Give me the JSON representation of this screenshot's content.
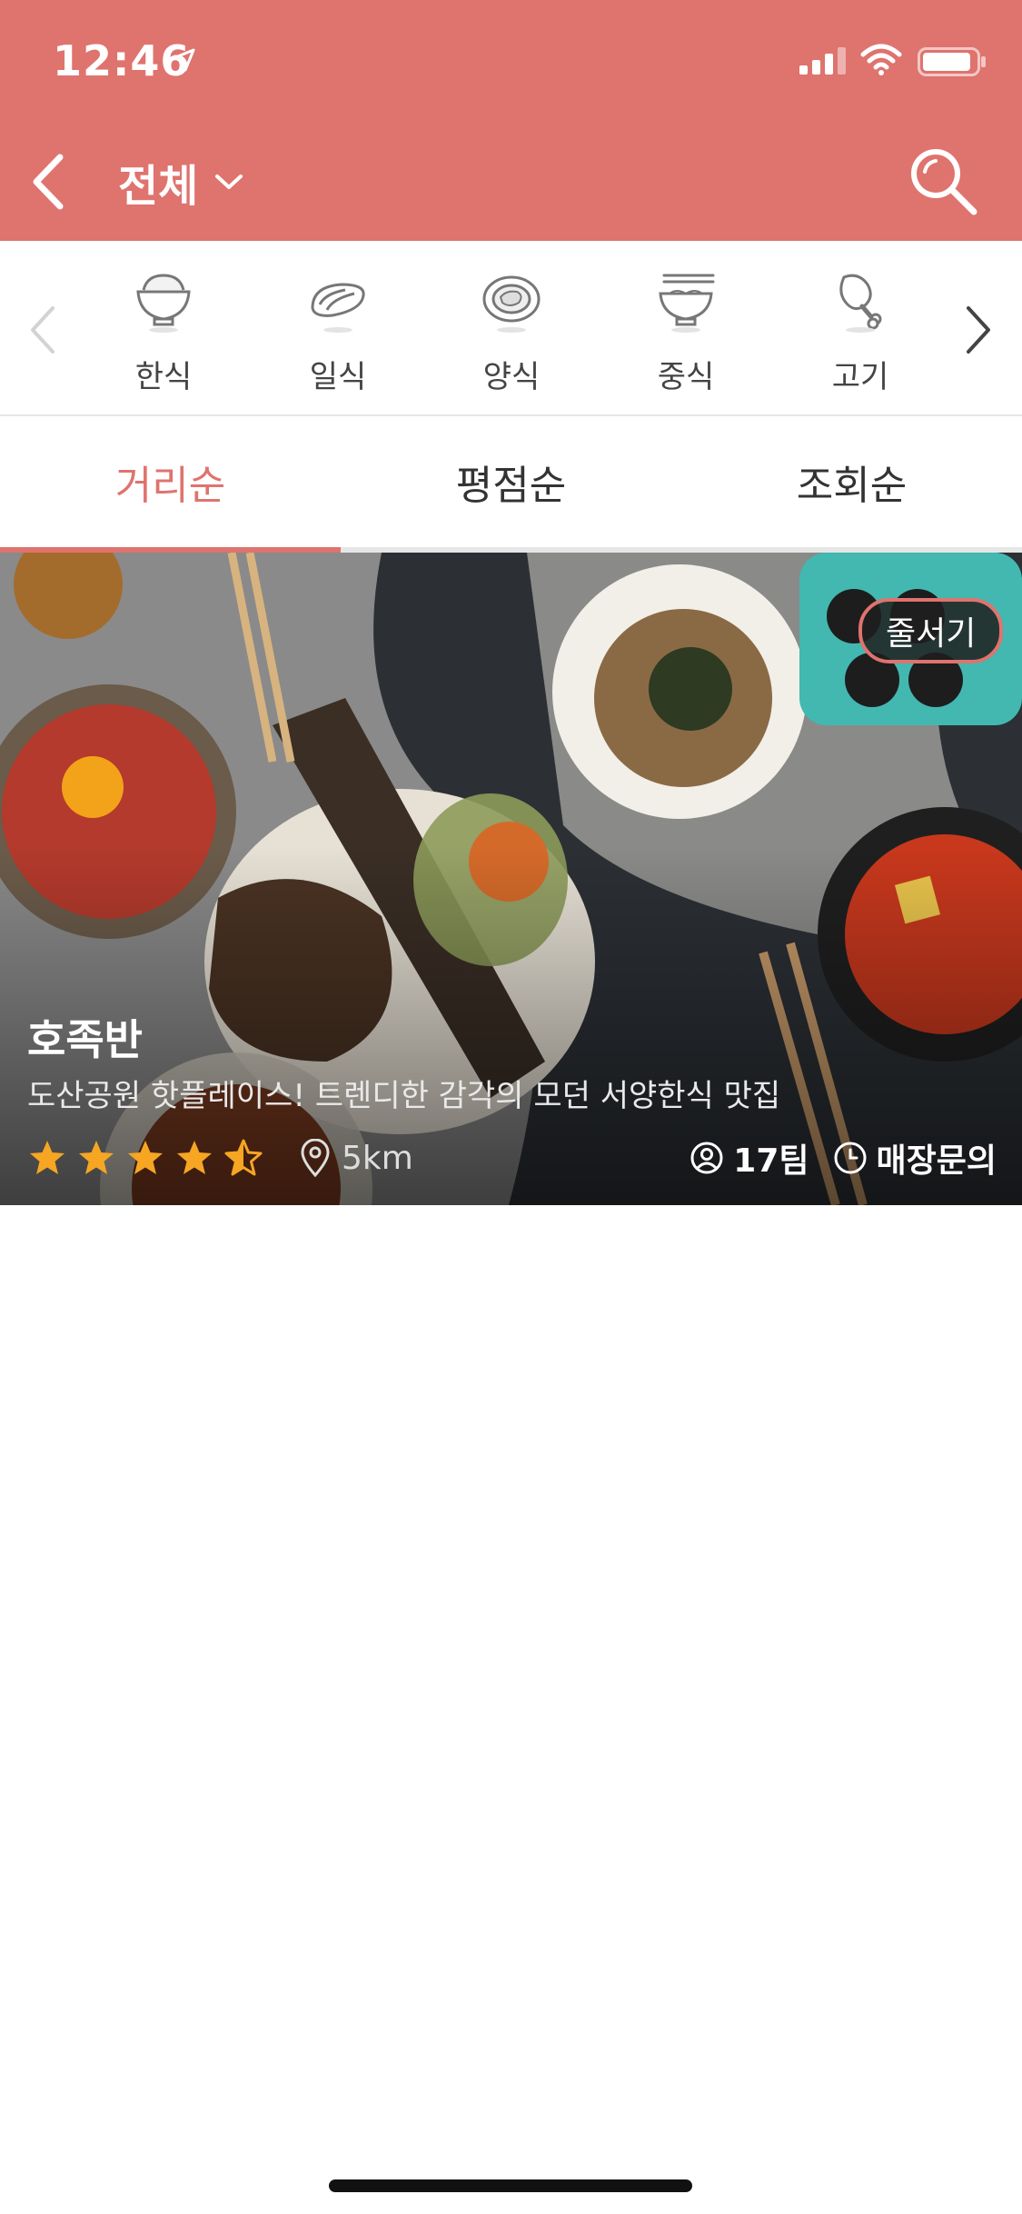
{
  "status_bar": {
    "time": "12:46"
  },
  "nav": {
    "title": "전체"
  },
  "categories": [
    {
      "label": "한식",
      "icon": "rice-bowl-icon"
    },
    {
      "label": "일식",
      "icon": "sushi-icon"
    },
    {
      "label": "양식",
      "icon": "steak-plate-icon"
    },
    {
      "label": "중식",
      "icon": "noodle-bowl-icon"
    },
    {
      "label": "고기",
      "icon": "drumstick-icon"
    }
  ],
  "tabs": [
    {
      "label": "거리순",
      "active": true
    },
    {
      "label": "평점순",
      "active": false
    },
    {
      "label": "조회순",
      "active": false
    }
  ],
  "restaurant": {
    "badge": "줄서기",
    "name": "호족반",
    "description": "도산공원 핫플레이스! 트렌디한 감각의 모던 서양한식 맛집",
    "rating": 4.5,
    "distance": "5km",
    "waiting_teams": "17팀",
    "store_inquiry": "매장문의"
  },
  "colors": {
    "accent": "#df736e",
    "star": "#f6a623",
    "tab_inactive": "#333333"
  }
}
